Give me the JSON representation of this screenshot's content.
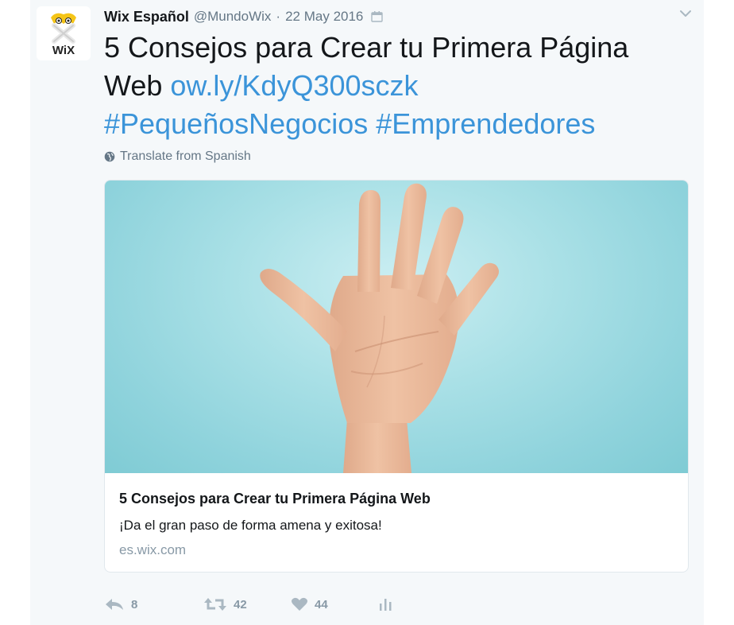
{
  "tweet": {
    "author": {
      "name": "Wix Español",
      "handle": "@MundoWix",
      "separator": "·",
      "date": "22 May 2016",
      "avatar_text": "WiX"
    },
    "text_main": "5 Consejos para Crear tu Primera Página Web ",
    "link": "ow.ly/KdyQ300sczk",
    "hashtags": "#PequeñosNegocios #Emprendedores",
    "translate_label": "Translate from Spanish"
  },
  "card": {
    "title": "5 Consejos para Crear tu Primera Página Web",
    "description": "¡Da el gran paso de forma amena y exitosa!",
    "domain": "es.wix.com"
  },
  "actions": {
    "reply_count": "8",
    "retweet_count": "42",
    "like_count": "44"
  },
  "colors": {
    "link": "#3b94d9",
    "muted": "#657786",
    "background": "#f5f8fa",
    "image_bg": "#a9e0e6"
  },
  "icons": [
    "wix-logo-icon",
    "calendar-icon",
    "chevron-down-icon",
    "globe-icon",
    "reply-icon",
    "retweet-icon",
    "heart-icon",
    "analytics-icon"
  ]
}
